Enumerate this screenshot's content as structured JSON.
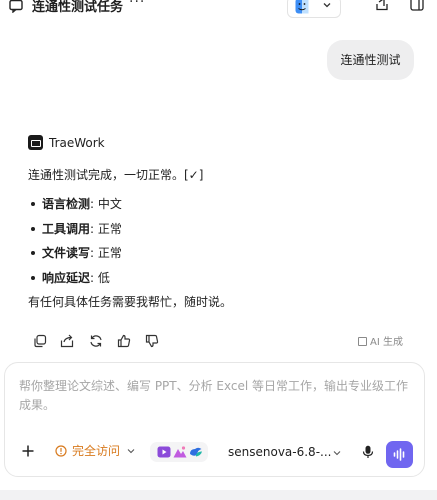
{
  "header": {
    "title": "连通性测试任务",
    "more_label": "···"
  },
  "user_message": "连通性测试",
  "assistant": {
    "name": "TraeWork",
    "intro": "连通性测试完成，一切正常。[✓]",
    "checks": [
      {
        "key": "语言检测",
        "sep": ": ",
        "value": "中文"
      },
      {
        "key": "工具调用",
        "sep": ": ",
        "value": "正常"
      },
      {
        "key": "文件读写",
        "sep": ": ",
        "value": "正常"
      },
      {
        "key": "响应延迟",
        "sep": ": ",
        "value": "低"
      }
    ],
    "outro": "有任何具体任务需要我帮忙，随时说。",
    "ai_generated_label": "AI 生成"
  },
  "composer": {
    "placeholder": "帮你整理论文综述、编写 PPT、分析 Excel 等日常工作，输出专业级工作成果。",
    "access_label": "完全访问",
    "model_name": "sensenova-6.8-..."
  },
  "colors": {
    "accent": "#7066f0",
    "access": "#d87a1e",
    "bubble": "#eeeeef"
  }
}
